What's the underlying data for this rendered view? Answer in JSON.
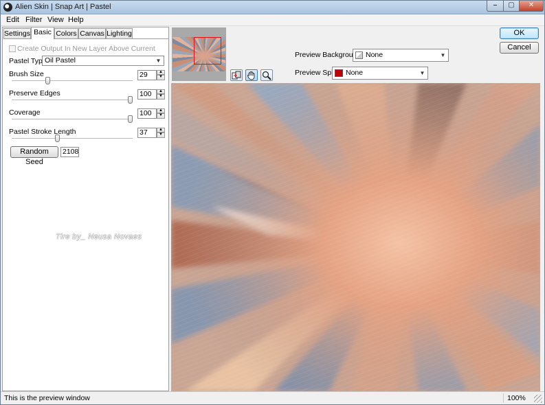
{
  "window": {
    "title": "Alien Skin | Snap Art | Pastel"
  },
  "menu": [
    "Edit",
    "Filter",
    "View",
    "Help"
  ],
  "tabs": [
    {
      "label": "Settings",
      "active": false
    },
    {
      "label": "Basic",
      "active": true
    },
    {
      "label": "Colors",
      "active": false
    },
    {
      "label": "Canvas",
      "active": false
    },
    {
      "label": "Lighting",
      "active": false
    }
  ],
  "basic": {
    "create_output_label": "Create Output In New Layer Above Current",
    "create_output_checked": false,
    "pastel_type_label": "Pastel Type:",
    "pastel_type_value": "Oil Pastel",
    "brush_size_label": "Brush Size",
    "brush_size_value": "29",
    "preserve_edges_label": "Preserve Edges",
    "preserve_edges_value": "100",
    "coverage_label": "Coverage",
    "coverage_value": "100",
    "stroke_length_label": "Pastel Stroke Length",
    "stroke_length_value": "37",
    "random_seed_label": "Random Seed",
    "random_seed_value": "2108"
  },
  "watermark": "Tire by_ Neusa Novaes",
  "buttons": {
    "ok": "OK",
    "cancel": "Cancel"
  },
  "preview_options": {
    "background_label": "Preview Background:",
    "background_value": "None",
    "split_label": "Preview Split:",
    "split_value": "None",
    "split_color": "#c00000"
  },
  "status": {
    "message": "This is the preview window",
    "zoom": "100%"
  },
  "colors": {
    "preview_base": "#c7a08a",
    "selection_rect": "#e81010",
    "ok_button_border": "#3c7fb1"
  },
  "tool_icons": [
    "compare-icon",
    "hand-pan-icon",
    "zoom-icon"
  ]
}
